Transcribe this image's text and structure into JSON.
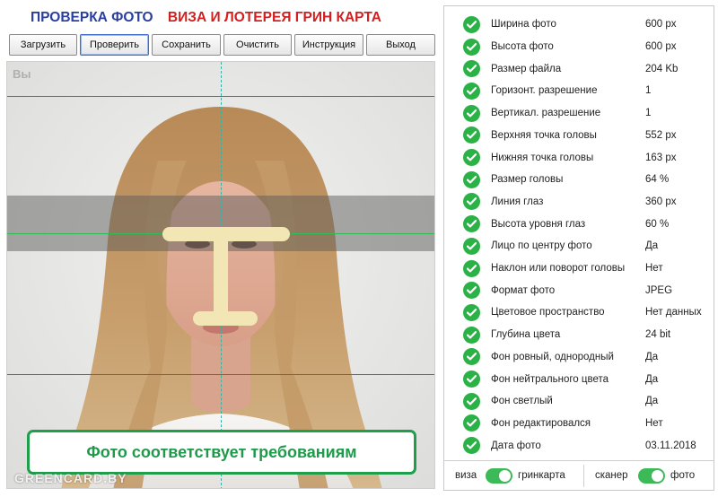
{
  "header": {
    "title_check": "ПРОВЕРКА ФОТО",
    "title_visa": "ВИЗА И ЛОТЕРЕЯ ГРИН КАРТА"
  },
  "toolbar": {
    "buttons": [
      "Загрузить",
      "Проверить",
      "Сохранить",
      "Очистить",
      "Инструкция",
      "Выход"
    ],
    "active": "Проверить"
  },
  "photo": {
    "you_label": "Вы",
    "result": "Фото соответствует требованиям",
    "watermark": "GREENCARD.BY"
  },
  "checks": [
    {
      "label": "Ширина фото",
      "value": "600 px",
      "status": "ok"
    },
    {
      "label": "Высота фото",
      "value": "600 px",
      "status": "ok"
    },
    {
      "label": "Размер файла",
      "value": "204 Kb",
      "status": "ok"
    },
    {
      "label": "Горизонт. разрешение",
      "value": "1",
      "status": "ok"
    },
    {
      "label": "Вертикал. разрешение",
      "value": "1",
      "status": "ok"
    },
    {
      "label": "Верхняя точка головы",
      "value": "552 px",
      "status": "ok"
    },
    {
      "label": "Нижняя точка головы",
      "value": "163 px",
      "status": "ok"
    },
    {
      "label": "Размер головы",
      "value": "64 %",
      "status": "ok"
    },
    {
      "label": "Линия глаз",
      "value": "360 px",
      "status": "ok"
    },
    {
      "label": "Высота уровня глаз",
      "value": "60 %",
      "status": "ok"
    },
    {
      "label": "Лицо по центру фото",
      "value": "Да",
      "status": "ok"
    },
    {
      "label": "Наклон или поворот головы",
      "value": "Нет",
      "status": "ok"
    },
    {
      "label": "Формат фото",
      "value": "JPEG",
      "status": "ok"
    },
    {
      "label": "Цветовое пространство",
      "value": "Нет данных",
      "status": "ok"
    },
    {
      "label": "Глубина цвета",
      "value": "24 bit",
      "status": "ok"
    },
    {
      "label": "Фон ровный, однородный",
      "value": "Да",
      "status": "ok"
    },
    {
      "label": "Фон нейтрального цвета",
      "value": "Да",
      "status": "ok"
    },
    {
      "label": "Фон светлый",
      "value": "Да",
      "status": "ok"
    },
    {
      "label": "Фон редактировался",
      "value": "Нет",
      "status": "ok"
    },
    {
      "label": "Дата фото",
      "value": "03.11.2018",
      "status": "ok"
    }
  ],
  "toggles": {
    "mode_left": "виза",
    "mode_right": "гринкарта",
    "mode_on": true,
    "source_left": "сканер",
    "source_right": "фото",
    "source_on": true
  },
  "colors": {
    "ok_green": "#2bb247",
    "title_blue": "#2a3f9e",
    "title_red": "#d21f1f",
    "guide_top": "#e03c3c",
    "guide_eyes": "#33bb55",
    "guide_chin": "#3f66e6"
  },
  "icons": {
    "check": "check-circle-icon"
  }
}
